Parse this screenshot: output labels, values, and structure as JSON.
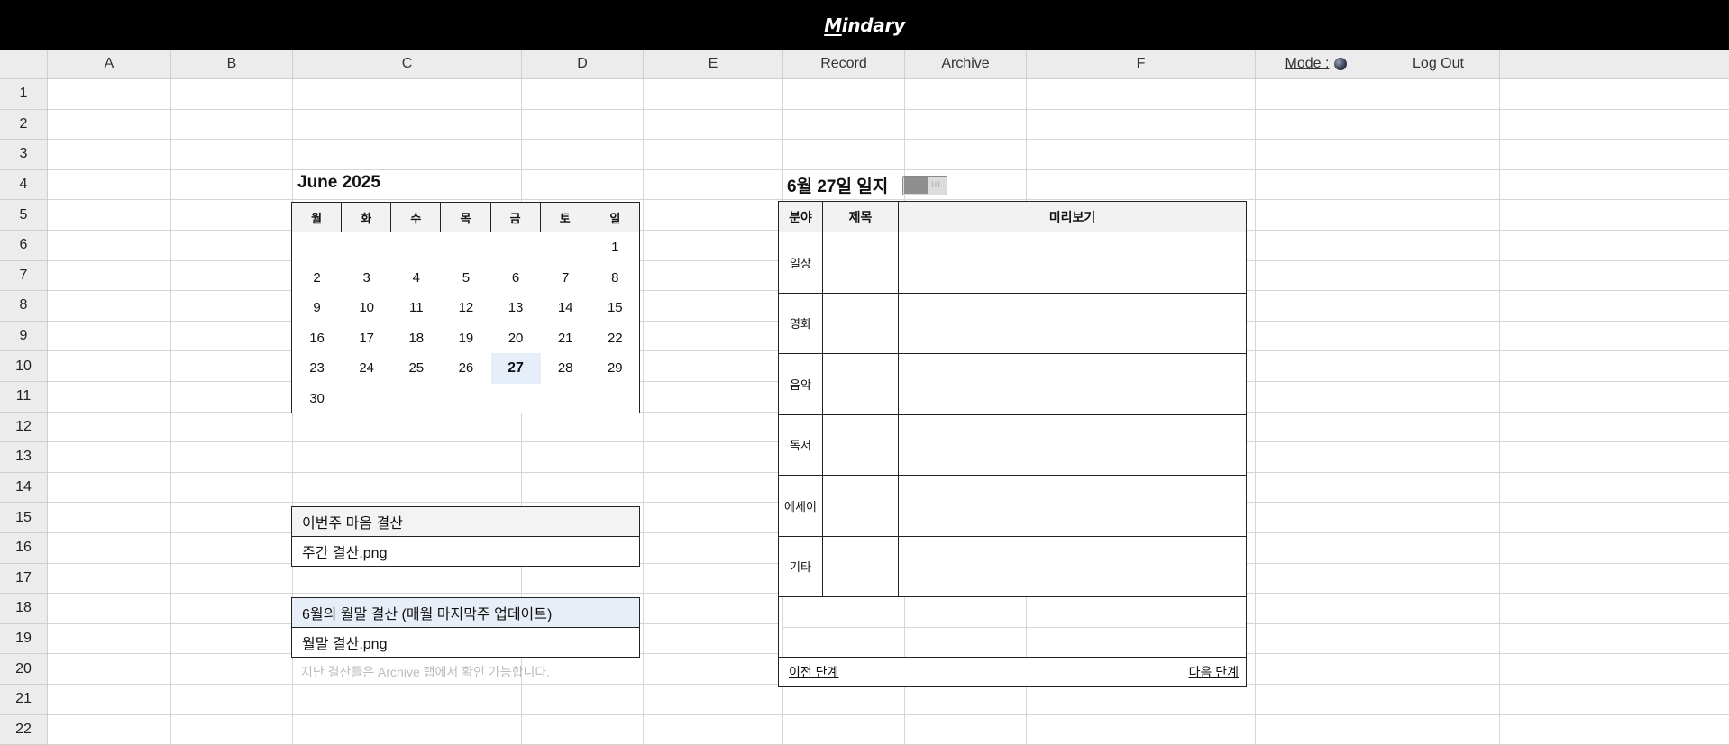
{
  "app": {
    "logo_first": "M",
    "logo_rest": "indary"
  },
  "columns": [
    {
      "label": "A"
    },
    {
      "label": "B"
    },
    {
      "label": "C"
    },
    {
      "label": "D"
    },
    {
      "label": "E"
    },
    {
      "label": "Record"
    },
    {
      "label": "Archive"
    },
    {
      "label": "F"
    },
    {
      "label": "Mode : "
    },
    {
      "label": "Log Out"
    }
  ],
  "rows": [
    "1",
    "2",
    "3",
    "4",
    "5",
    "6",
    "7",
    "8",
    "9",
    "10",
    "11",
    "12",
    "13",
    "14",
    "15",
    "16",
    "17",
    "18",
    "19",
    "20",
    "21",
    "22"
  ],
  "mode": {
    "icon": "moon-icon"
  },
  "calendar": {
    "title": "June 2025",
    "weekdays": [
      "월",
      "화",
      "수",
      "목",
      "금",
      "토",
      "일"
    ],
    "days": [
      "",
      "",
      "",
      "",
      "",
      "",
      "1",
      "2",
      "3",
      "4",
      "5",
      "6",
      "7",
      "8",
      "9",
      "10",
      "11",
      "12",
      "13",
      "14",
      "15",
      "16",
      "17",
      "18",
      "19",
      "20",
      "21",
      "22",
      "23",
      "24",
      "25",
      "26",
      "27",
      "28",
      "29",
      "30",
      "",
      "",
      "",
      "",
      "",
      ""
    ],
    "today": "27"
  },
  "weekly": {
    "title": "이번주 마음 결산",
    "file": "주간 결산.png"
  },
  "monthly": {
    "title": "6월의 월말 결산 (매월 마지막주 업데이트)",
    "file": "월말 결산.png"
  },
  "archive_note": "지난 결산들은 Archive 탭에서 확인 가능합니다.",
  "journal": {
    "title": "6월 27일 일지",
    "headers": [
      "분야",
      "제목",
      "미리보기"
    ],
    "categories": [
      "일상",
      "영화",
      "음악",
      "독서",
      "에세이",
      "기타"
    ],
    "prev": "이전 단계",
    "next": "다음 단계"
  },
  "colors": {
    "topbar": "#000000",
    "today_highlight": "#e6eef9",
    "header_bg": "#ececec"
  }
}
